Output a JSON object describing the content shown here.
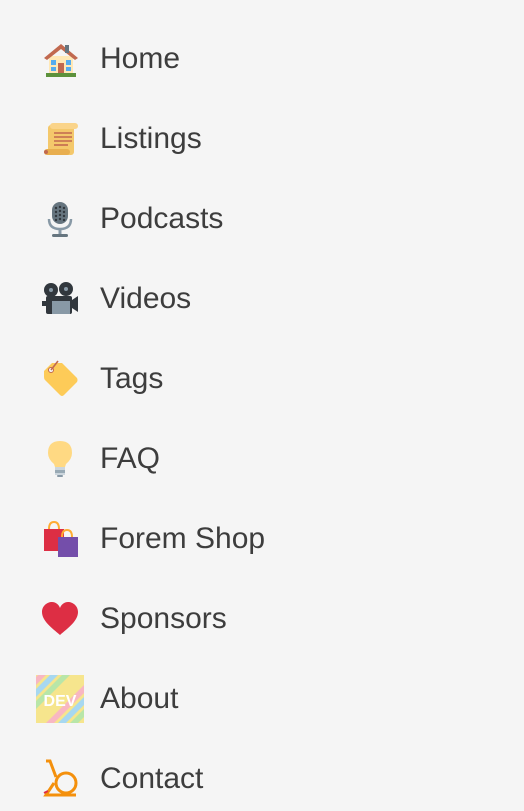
{
  "sidebar": {
    "items": [
      {
        "label": "Home",
        "icon": "house-icon"
      },
      {
        "label": "Listings",
        "icon": "scroll-icon"
      },
      {
        "label": "Podcasts",
        "icon": "microphone-icon"
      },
      {
        "label": "Videos",
        "icon": "film-projector-icon"
      },
      {
        "label": "Tags",
        "icon": "tag-icon"
      },
      {
        "label": "FAQ",
        "icon": "light-bulb-icon"
      },
      {
        "label": "Forem Shop",
        "icon": "shopping-bags-icon"
      },
      {
        "label": "Sponsors",
        "icon": "heart-icon"
      },
      {
        "label": "About",
        "icon": "dev-logo-icon"
      },
      {
        "label": "Contact",
        "icon": "postal-horn-icon"
      }
    ]
  },
  "colors": {
    "background": "#f5f5f5",
    "text": "#3d3d3d",
    "heart": "#dd2e44"
  }
}
